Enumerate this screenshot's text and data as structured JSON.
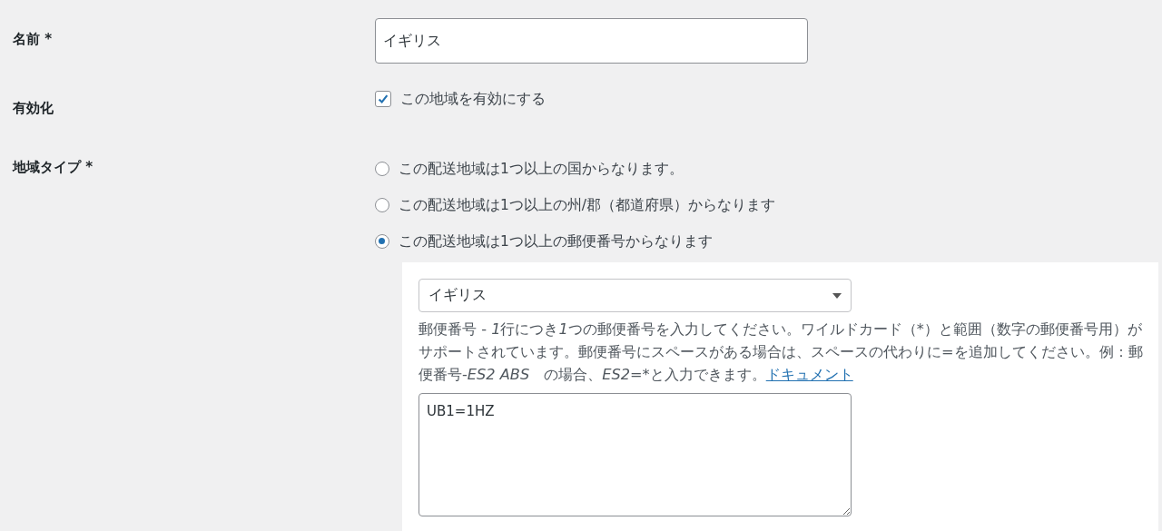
{
  "name_field": {
    "label": "名前 *",
    "value": "イギリス"
  },
  "enabled": {
    "label": "有効化",
    "checkbox_label": "この地域を有効にする",
    "checked": true
  },
  "region_type": {
    "label": "地域タイプ *",
    "options": [
      {
        "label": "この配送地域は1つ以上の国からなります。",
        "selected": false
      },
      {
        "label": "この配送地域は1つ以上の州/郡（都道府県）からなります",
        "selected": false
      },
      {
        "label": "この配送地域は1つ以上の郵便番号からなります",
        "selected": true
      }
    ]
  },
  "postcode_panel": {
    "country_select": {
      "value": "イギリス"
    },
    "description": [
      {
        "text": "郵便番号 - ",
        "kind": "plain"
      },
      {
        "text": "1",
        "kind": "italic"
      },
      {
        "text": "行につき",
        "kind": "plain"
      },
      {
        "text": "1",
        "kind": "italic"
      },
      {
        "text": "つの郵便番号を入力してください。ワイルドカード（*）と範囲（数字の郵便番号用）がサポートされています。郵便番号にスペースがある場合は、スペースの代わりに=を追加してください。例：郵便番号-",
        "kind": "plain"
      },
      {
        "text": "ES2 ABS",
        "kind": "italic"
      },
      {
        "text": "　の場合、",
        "kind": "plain"
      },
      {
        "text": "ES2=*",
        "kind": "italic"
      },
      {
        "text": "と入力できます。",
        "kind": "plain"
      },
      {
        "text": "ドキュメント",
        "kind": "link"
      }
    ],
    "postcodes": {
      "value": "UB1=1HZ"
    }
  }
}
